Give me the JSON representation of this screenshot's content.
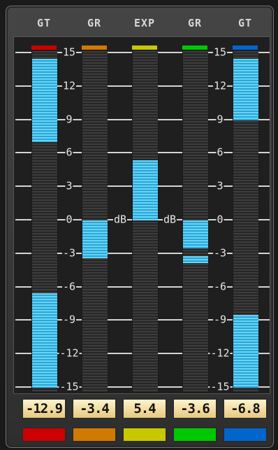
{
  "meters": [
    {
      "header": "GT",
      "color": "#cc0000",
      "value_label": "-12.9",
      "fills": [
        {
          "from": 14.5,
          "to": 7
        },
        {
          "from": -6.5,
          "to": -15
        }
      ]
    },
    {
      "header": "GR",
      "color": "#d07a00",
      "value_label": "-3.4",
      "fills": [
        {
          "from": 0,
          "to": -3.4
        }
      ]
    },
    {
      "header": "EXP",
      "color": "#c8c800",
      "value_label": "5.4",
      "fills": [
        {
          "from": 5.4,
          "to": 0
        }
      ]
    },
    {
      "header": "GR",
      "color": "#00c800",
      "value_label": "-3.6",
      "fills": [
        {
          "from": 0,
          "to": -2.5
        },
        {
          "from": -3.2,
          "to": -3.8
        }
      ]
    },
    {
      "header": "GT",
      "color": "#0066cc",
      "value_label": "-6.8",
      "fills": [
        {
          "from": 14.5,
          "to": 9
        },
        {
          "from": -8.5,
          "to": -15
        }
      ]
    }
  ],
  "scale": {
    "min": -15,
    "max": 15,
    "labels": [
      "15",
      "12",
      "9",
      "6",
      "3",
      "0",
      "-3",
      "-6",
      "-9",
      "-12",
      "-15"
    ],
    "unit": "dB"
  }
}
